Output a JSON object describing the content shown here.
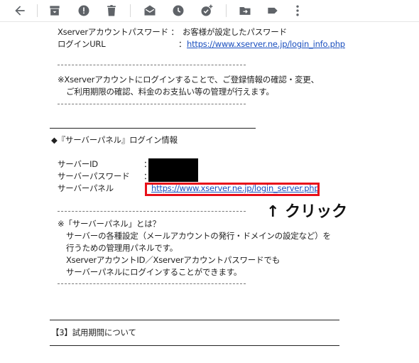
{
  "toolbar": {
    "icons": [
      "back-arrow-icon",
      "archive-icon",
      "report-spam-icon",
      "delete-icon",
      "mark-unread-icon",
      "snooze-icon",
      "add-to-tasks-icon",
      "move-to-icon",
      "label-icon",
      "more-vert-icon"
    ]
  },
  "email": {
    "acct_pw_label": "Xserverアカウントパスワード ：",
    "acct_pw_value": "お客様が設定したパスワード",
    "login_url_label": "ログインURL",
    "login_url_colon": "：",
    "login_url_link": "https://www.xserver.ne.jp/login_info.php",
    "note1_line1": "※Xserverアカウントにログインすることで、ご登録情報の確認・変更、",
    "note1_line2": "ご利用期限の確認、料金のお支払い等の管理が行えます。",
    "section_heading": "◆『サーバーパネル』ログイン情報",
    "server_id_label": "サーバーID",
    "server_id_colon": "：",
    "server_pw_label": "サーバーパスワード",
    "server_pw_colon": "：",
    "server_panel_label": "サーバーパネル",
    "server_panel_colon": "：",
    "server_panel_link": "https://www.xserver.ne.jp/login_server.php",
    "annotation": "↑ クリック",
    "note2_title": "※「サーバーパネル」とは？",
    "note2_line1": "サーバーの各種設定（メールアカウントの発行・ドメインの設定など）を",
    "note2_line2": "行うための管理用パネルです。",
    "note2_line3": "XserverアカウントID／Xserverアカウントパスワードでも",
    "note2_line4": "サーバーパネルにログインすることができます。",
    "section3_heading": "【3】試用期間について"
  },
  "colors": {
    "highlight_box": "#e8101a",
    "link": "#1a4fbf",
    "icon": "#5f6368"
  }
}
